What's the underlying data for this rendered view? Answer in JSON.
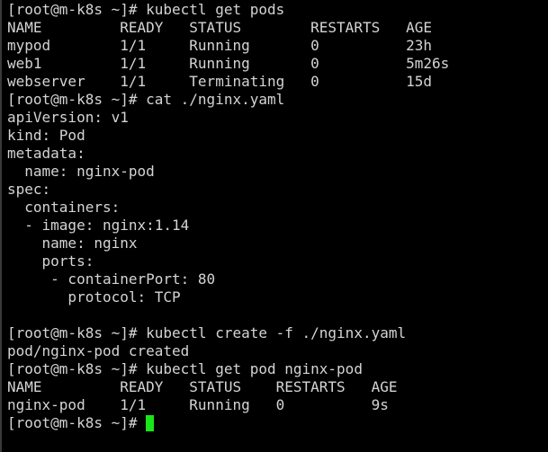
{
  "terminal": {
    "cursor_color": "#19e619",
    "text_color": "#d4d4d4",
    "background_color": "#000000",
    "lines": [
      "[root@m-k8s ~]# kubectl get pods",
      "NAME         READY   STATUS        RESTARTS   AGE",
      "mypod        1/1     Running       0          23h",
      "web1         1/1     Running       0          5m26s",
      "webserver    1/1     Terminating   0          15d",
      "[root@m-k8s ~]# cat ./nginx.yaml",
      "apiVersion: v1",
      "kind: Pod",
      "metadata:",
      "  name: nginx-pod",
      "spec:",
      "  containers:",
      "  - image: nginx:1.14",
      "    name: nginx",
      "    ports:",
      "     - containerPort: 80",
      "       protocol: TCP",
      "",
      "[root@m-k8s ~]# kubectl create -f ./nginx.yaml",
      "pod/nginx-pod created",
      "[root@m-k8s ~]# kubectl get pod nginx-pod",
      "NAME         READY   STATUS    RESTARTS   AGE",
      "nginx-pod    1/1     Running   0          9s"
    ],
    "prompt": "[root@m-k8s ~]# "
  }
}
